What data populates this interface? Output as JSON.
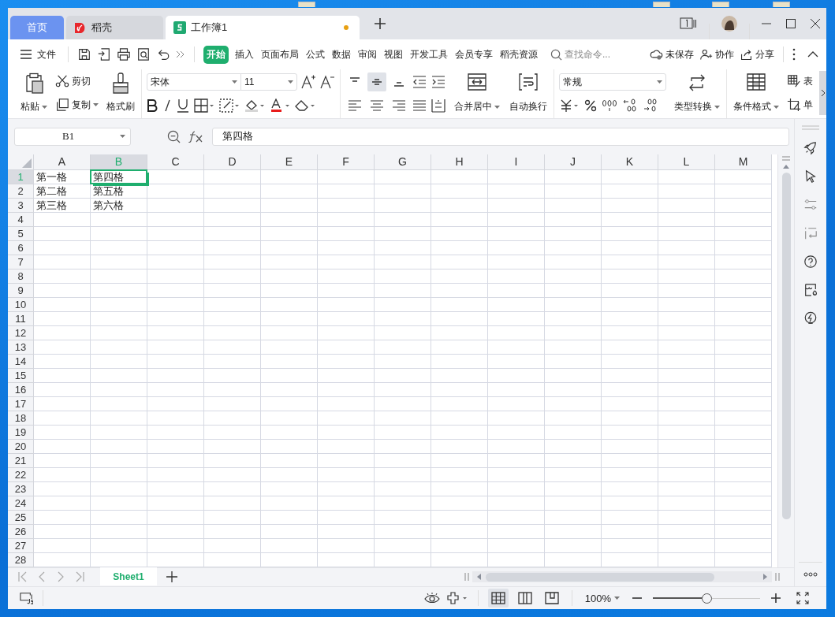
{
  "window": {
    "tabs": [
      {
        "kind": "home",
        "label": "首页",
        "selected": false
      },
      {
        "kind": "docer",
        "label": "稻壳",
        "selected": false
      },
      {
        "kind": "sheet",
        "label": "工作簿1",
        "selected": true,
        "unsaved": true
      }
    ]
  },
  "menu": {
    "file": "文件",
    "tabs": [
      {
        "label": "开始",
        "selected": true
      },
      {
        "label": "插入",
        "selected": false
      },
      {
        "label": "页面布局",
        "selected": false
      },
      {
        "label": "公式",
        "selected": false
      },
      {
        "label": "数据",
        "selected": false
      },
      {
        "label": "审阅",
        "selected": false
      },
      {
        "label": "视图",
        "selected": false
      },
      {
        "label": "开发工具",
        "selected": false
      },
      {
        "label": "会员专享",
        "selected": false
      },
      {
        "label": "稻壳资源",
        "selected": false
      }
    ],
    "search": {
      "placeholder": "查找命令..."
    },
    "actions": [
      {
        "kind": "cloud",
        "label": "未保存"
      },
      {
        "kind": "collab",
        "label": "协作"
      },
      {
        "kind": "share",
        "label": "分享"
      }
    ]
  },
  "ribbon": {
    "paste": "粘贴",
    "cut": "剪切",
    "copy": "复制",
    "format_painter": "格式刷",
    "font": "宋体",
    "font_size": "11",
    "vertical_align": [
      {
        "selected": false
      },
      {
        "selected": true
      },
      {
        "selected": false
      }
    ],
    "merge": "合并居中",
    "wrap": "自动换行",
    "number_format": "常规",
    "convert": "类型转换",
    "conditional_format": "条件格式",
    "table_style": "表",
    "cell_style": "单"
  },
  "formula_bar": {
    "name_box": "B1",
    "value": "第四格"
  },
  "columns": [
    {
      "label": "A",
      "selected": false
    },
    {
      "label": "B",
      "selected": true
    },
    {
      "label": "C",
      "selected": false
    },
    {
      "label": "D",
      "selected": false
    },
    {
      "label": "E",
      "selected": false
    },
    {
      "label": "F",
      "selected": false
    },
    {
      "label": "G",
      "selected": false
    },
    {
      "label": "H",
      "selected": false
    },
    {
      "label": "I",
      "selected": false
    },
    {
      "label": "J",
      "selected": false
    },
    {
      "label": "K",
      "selected": false
    },
    {
      "label": "L",
      "selected": false
    },
    {
      "label": "M",
      "selected": false
    }
  ],
  "rows": [
    {
      "label": "1",
      "selected": true,
      "cells": [
        "第一格",
        "第四格"
      ]
    },
    {
      "label": "2",
      "selected": false,
      "cells": [
        "第二格",
        "第五格"
      ]
    },
    {
      "label": "3",
      "selected": false,
      "cells": [
        "第三格",
        "第六格"
      ]
    },
    {
      "label": "4",
      "selected": false
    },
    {
      "label": "5",
      "selected": false
    },
    {
      "label": "6",
      "selected": false
    },
    {
      "label": "7",
      "selected": false
    },
    {
      "label": "8",
      "selected": false
    },
    {
      "label": "9",
      "selected": false
    },
    {
      "label": "10",
      "selected": false
    },
    {
      "label": "11",
      "selected": false
    },
    {
      "label": "12",
      "selected": false
    },
    {
      "label": "13",
      "selected": false
    },
    {
      "label": "14",
      "selected": false
    },
    {
      "label": "15",
      "selected": false
    },
    {
      "label": "16",
      "selected": false
    },
    {
      "label": "17",
      "selected": false
    },
    {
      "label": "18",
      "selected": false
    },
    {
      "label": "19",
      "selected": false
    },
    {
      "label": "20",
      "selected": false
    },
    {
      "label": "21",
      "selected": false
    },
    {
      "label": "22",
      "selected": false
    },
    {
      "label": "23",
      "selected": false
    },
    {
      "label": "24",
      "selected": false
    },
    {
      "label": "25",
      "selected": false
    },
    {
      "label": "26",
      "selected": false
    },
    {
      "label": "27",
      "selected": false
    },
    {
      "label": "28",
      "selected": false
    }
  ],
  "sheets": [
    {
      "label": "Sheet1",
      "selected": true
    }
  ],
  "status_bar": {
    "views": [
      {
        "kind": "normal",
        "selected": true
      },
      {
        "kind": "reading",
        "selected": false
      },
      {
        "kind": "page",
        "selected": false
      }
    ],
    "zoom": "100%",
    "zoom_slider": {
      "level": 0.5
    }
  }
}
